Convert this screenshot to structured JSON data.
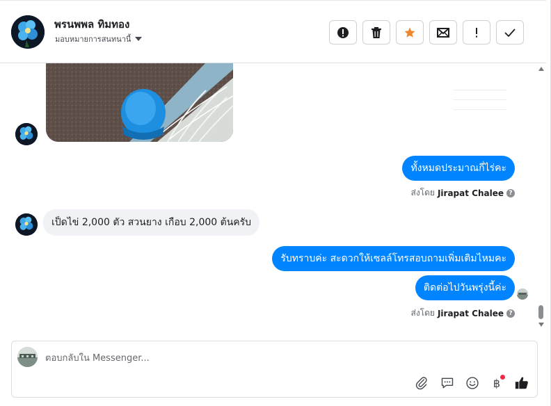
{
  "header": {
    "contact_name": "พรนพพล ทิมทอง",
    "assign_label": "มอบหมายการสนทนานี้",
    "actions": [
      {
        "name": "report-spam-button",
        "icon": "exclamation-circle-icon"
      },
      {
        "name": "delete-button",
        "icon": "trash-icon"
      },
      {
        "name": "star-button",
        "icon": "star-icon",
        "color": "#f0862c"
      },
      {
        "name": "mark-unread-button",
        "icon": "envelope-icon"
      },
      {
        "name": "mark-important-button",
        "icon": "exclamation-icon"
      },
      {
        "name": "mark-done-button",
        "icon": "check-icon"
      }
    ]
  },
  "thread": {
    "messages": [
      {
        "type": "image",
        "direction": "incoming"
      },
      {
        "type": "text",
        "direction": "outgoing",
        "text": "ทั้งหมดประมาณกี่ไร่คะ"
      },
      {
        "type": "text",
        "direction": "incoming",
        "text": "เป็ดไข่ 2,000 ตัว สวนยาง เกือบ 2,000 ต้นครับ"
      },
      {
        "type": "text",
        "direction": "outgoing",
        "text": "รับทราบค่ะ สะดวกให้เซลล์โทรสอบถามเพิ่มเติมไหมคะ"
      },
      {
        "type": "text",
        "direction": "outgoing",
        "text": "ติดต่อไปวันพรุ่งนี้ค่ะ"
      }
    ],
    "sent_by": {
      "prefix": "ส่งโดย",
      "agent": "Jirapat Chalee"
    }
  },
  "composer": {
    "placeholder": "ตอบกลับใน Messenger...",
    "tools": [
      "paperclip-icon",
      "saved-reply-icon",
      "emoji-icon",
      "baht-icon",
      "thumbs-up-icon"
    ],
    "baht_symbol": "฿"
  },
  "colors": {
    "accent": "#0084ff",
    "incoming_bubble": "#f0f2f5",
    "star": "#f0862c",
    "notify": "#f02849"
  }
}
